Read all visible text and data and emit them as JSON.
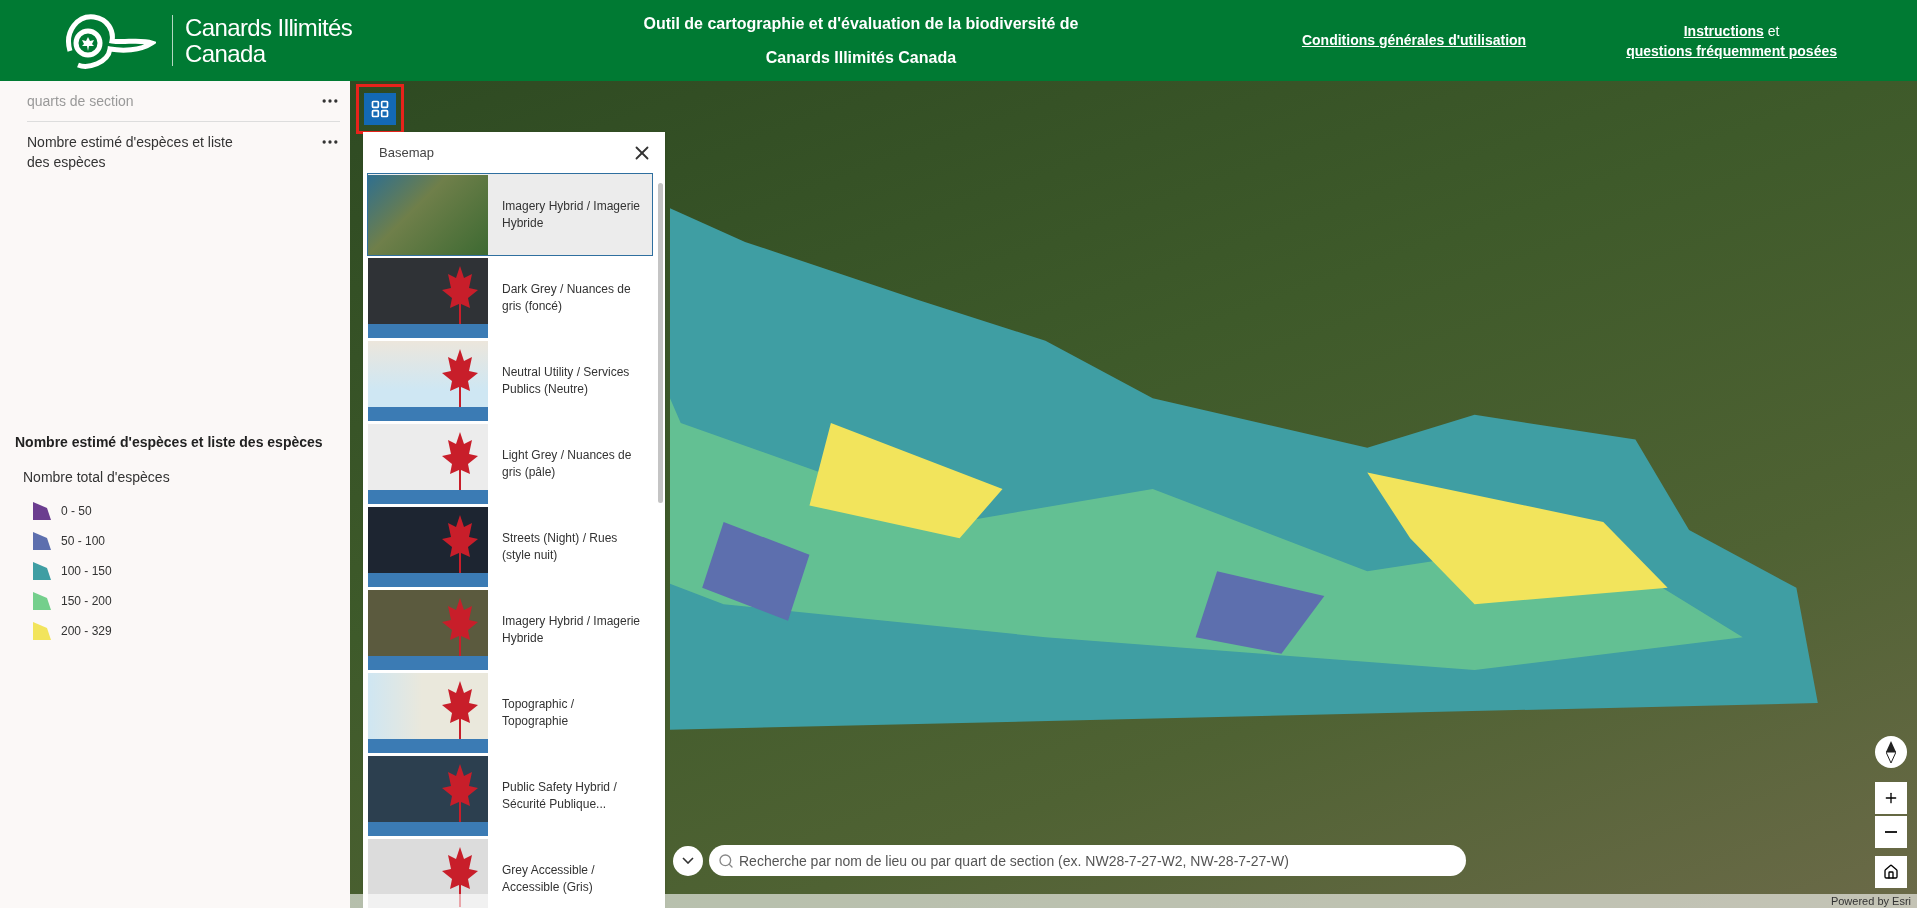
{
  "header": {
    "logo": {
      "line_1": "Canards Illimités",
      "line_2": "Canada"
    },
    "title_lines": [
      "Outil de cartographie et d'évaluation de la biodiversité de",
      "Canards Illimités Canada"
    ],
    "terms_link": "Conditions générales d'utilisation",
    "help": {
      "link_1": "Instructions",
      "joiner": "et",
      "link_2": "questions fréquemment posées"
    }
  },
  "layers": [
    {
      "label": "quarts de section",
      "dimmed": true
    },
    {
      "label": "Nombre estimé d'espèces et liste des espèces",
      "dimmed": false
    }
  ],
  "legend": {
    "title": "Nombre estimé d'espèces et liste des espèces",
    "subtitle": "Nombre total d'espèces",
    "classes": [
      {
        "label": "0 - 50",
        "color": "#6b3d8f"
      },
      {
        "label": "50 - 100",
        "color": "#5d6fae"
      },
      {
        "label": "100 - 150",
        "color": "#3f9ea3"
      },
      {
        "label": "150 - 200",
        "color": "#74cf8c"
      },
      {
        "label": "200 - 329",
        "color": "#f2e45c"
      }
    ]
  },
  "basemap": {
    "title": "Basemap",
    "items": [
      {
        "label": "Imagery Hybrid / Imagerie Hybride",
        "selected": true,
        "kind": "imagery"
      },
      {
        "label": "Dark Grey / Nuances de gris (foncé)",
        "selected": false,
        "kind": "dark"
      },
      {
        "label": "Neutral Utility / Services Publics (Neutre)",
        "selected": false,
        "kind": "neutral"
      },
      {
        "label": "Light Grey / Nuances de gris (pâle)",
        "selected": false,
        "kind": "light"
      },
      {
        "label": "Streets (Night) / Rues (style nuit)",
        "selected": false,
        "kind": "night"
      },
      {
        "label": "Imagery Hybrid / Imagerie Hybride",
        "selected": false,
        "kind": "imagery_city"
      },
      {
        "label": "Topographic / Topographie",
        "selected": false,
        "kind": "topo"
      },
      {
        "label": "Public Safety Hybrid / Sécurité Publique...",
        "selected": false,
        "kind": "safety"
      },
      {
        "label": "Grey Accessible / Accessible (Gris)",
        "selected": false,
        "kind": "grey"
      }
    ]
  },
  "search": {
    "placeholder": "Recherche par nom de lieu ou par quart de section (ex. NW28-7-27-W2, NW-28-7-27-W)"
  },
  "attribution": "Powered by Esri"
}
